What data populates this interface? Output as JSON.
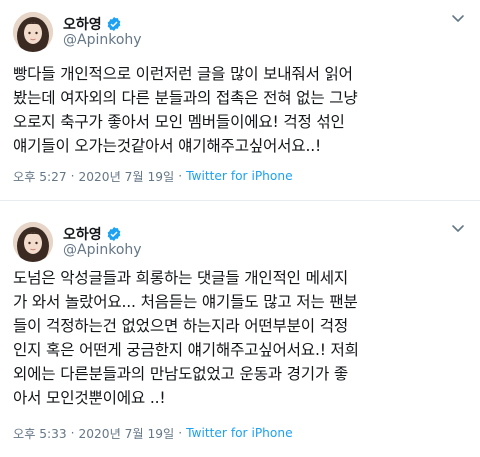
{
  "tweets": [
    {
      "display_name": "오하영",
      "handle": "@Apinkohy",
      "text": "빵다들 개인적으로 이런저런 글을 많이 보내줘서 읽어\n봤는데 여자외의 다른 분들과의 접촉은 전혀 없는 그냥\n오로지 축구가 좋아서 모인 멤버들이에요! 걱정 섞인\n얘기들이 오가는것같아서 얘기해주고싶어서요..!",
      "time": "오후 5:27",
      "date": "2020년 7월 19일",
      "source": "Twitter for iPhone"
    },
    {
      "display_name": "오하영",
      "handle": "@Apinkohy",
      "text": "도넘은 악성글들과 희롱하는 댓글들 개인적인 메세지\n가 와서 놀랐어요... 처음듣는 얘기들도 많고 저는 팬분\n들이 걱정하는건 없었으면 하는지라 어떤부분이 걱정\n인지 혹은 어떤게 궁금한지 얘기해주고싶어서요.! 저희\n외에는 다른분들과의 만남도없었고 운동과 경기가 좋\n아서 모인것뿐이에요 ..!",
      "time": "오후 5:33",
      "date": "2020년 7월 19일",
      "source": "Twitter for iPhone"
    }
  ],
  "icons": {
    "verified": "verified-badge-icon",
    "more": "chevron-down-icon",
    "avatar": "profile-photo"
  },
  "colors": {
    "accent": "#1da1f2",
    "secondary_text": "#657786",
    "primary_text": "#14171a",
    "divider": "#e6ecf0"
  }
}
